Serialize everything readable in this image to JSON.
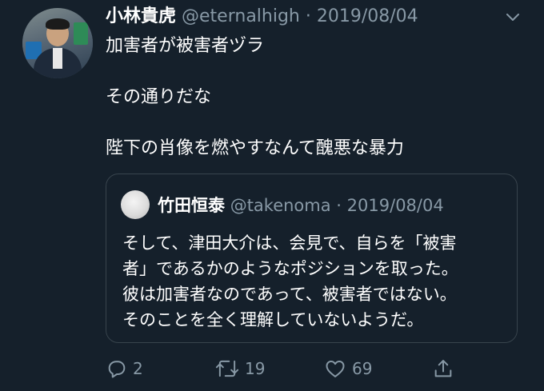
{
  "tweet": {
    "author_name": "小林貴虎",
    "author_handle": "@eternalhigh",
    "separator": "·",
    "date": "2019/08/04",
    "text_lines": [
      "加害者が被害者ヅラ",
      "その通りだな",
      "陛下の肖像を燃やすなんて醜悪な暴力"
    ]
  },
  "quoted": {
    "author_name": "竹田恒泰",
    "author_handle": "@takenoma",
    "separator": "·",
    "date": "2019/08/04",
    "text_lines": [
      "そして、津田大介は、会見で、自らを「被害",
      "者」であるかのようなポジションを取った。",
      "彼は加害者なのであって、被害者ではない。",
      "そのことを全く理解していないようだ。"
    ]
  },
  "actions": {
    "reply_count": "2",
    "retweet_count": "19",
    "like_count": "69"
  },
  "icons": {
    "reply": "reply-icon",
    "retweet": "retweet-icon",
    "like": "heart-icon",
    "share": "share-icon",
    "menu": "chevron-down-icon"
  },
  "colors": {
    "background": "#15202b",
    "secondary_text": "#8899a6",
    "border": "#38444d",
    "primary_text": "#ffffff"
  }
}
